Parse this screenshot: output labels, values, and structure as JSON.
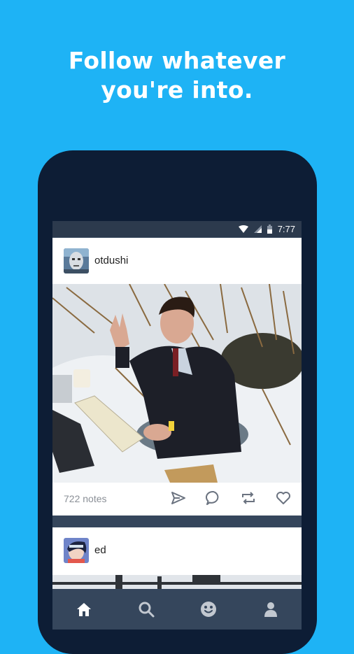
{
  "headline": {
    "line1": "Follow whatever",
    "line2": "you're into."
  },
  "statusbar": {
    "time": "7:77",
    "icons": [
      "wifi-icon",
      "cell-signal-icon",
      "battery-icon"
    ]
  },
  "posts": [
    {
      "username": "otdushi",
      "notes": "722 notes",
      "actions": [
        "share-icon",
        "reply-icon",
        "reblog-icon",
        "like-icon"
      ]
    },
    {
      "username": "ed"
    }
  ],
  "navbar": {
    "items": [
      "home-icon",
      "search-icon",
      "smiley-icon",
      "account-icon"
    ]
  },
  "colors": {
    "background": "#1eb3f5",
    "phone": "#0d1d35",
    "navbar": "#35465c",
    "statusbar": "#2c3a4d"
  }
}
